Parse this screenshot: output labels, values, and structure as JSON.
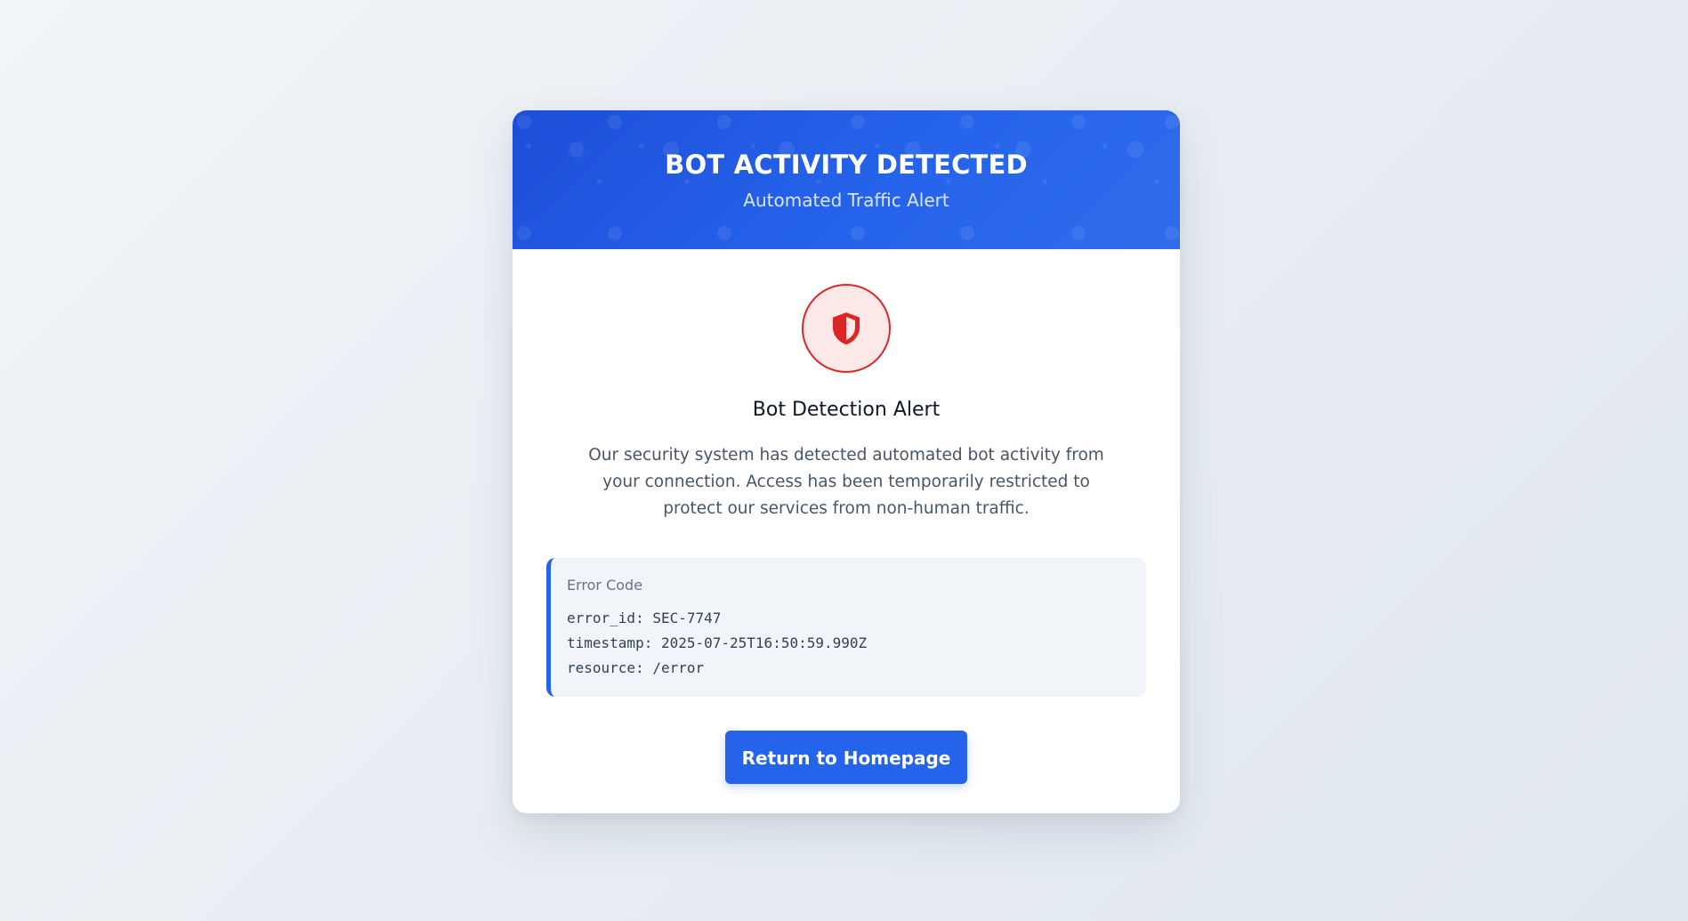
{
  "header": {
    "title": "BOT ACTIVITY DETECTED",
    "subtitle": "Automated Traffic Alert"
  },
  "alert": {
    "icon": "shield-icon",
    "title": "Bot Detection Alert",
    "message": "Our security system has detected automated bot activity from your connection. Access has been temporarily restricted to protect our services from non-human traffic."
  },
  "error": {
    "label": "Error Code",
    "lines": [
      "error_id: SEC-7747",
      "timestamp: 2025-07-25T16:50:59.990Z",
      "resource: /error"
    ]
  },
  "actions": {
    "return_label": "Return to Homepage"
  },
  "colors": {
    "primary": "#2563eb",
    "danger": "#dc2626",
    "danger_bg": "#fde8e8",
    "text_dark": "#0f172a",
    "text_muted": "#475569"
  }
}
